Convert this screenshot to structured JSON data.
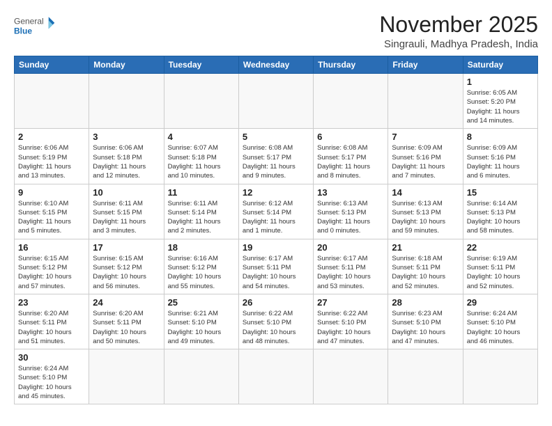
{
  "header": {
    "logo_general": "General",
    "logo_blue": "Blue",
    "title": "November 2025",
    "subtitle": "Singrauli, Madhya Pradesh, India"
  },
  "weekdays": [
    "Sunday",
    "Monday",
    "Tuesday",
    "Wednesday",
    "Thursday",
    "Friday",
    "Saturday"
  ],
  "weeks": [
    [
      {
        "day": "",
        "info": ""
      },
      {
        "day": "",
        "info": ""
      },
      {
        "day": "",
        "info": ""
      },
      {
        "day": "",
        "info": ""
      },
      {
        "day": "",
        "info": ""
      },
      {
        "day": "",
        "info": ""
      },
      {
        "day": "1",
        "info": "Sunrise: 6:05 AM\nSunset: 5:20 PM\nDaylight: 11 hours\nand 14 minutes."
      }
    ],
    [
      {
        "day": "2",
        "info": "Sunrise: 6:06 AM\nSunset: 5:19 PM\nDaylight: 11 hours\nand 13 minutes."
      },
      {
        "day": "3",
        "info": "Sunrise: 6:06 AM\nSunset: 5:18 PM\nDaylight: 11 hours\nand 12 minutes."
      },
      {
        "day": "4",
        "info": "Sunrise: 6:07 AM\nSunset: 5:18 PM\nDaylight: 11 hours\nand 10 minutes."
      },
      {
        "day": "5",
        "info": "Sunrise: 6:08 AM\nSunset: 5:17 PM\nDaylight: 11 hours\nand 9 minutes."
      },
      {
        "day": "6",
        "info": "Sunrise: 6:08 AM\nSunset: 5:17 PM\nDaylight: 11 hours\nand 8 minutes."
      },
      {
        "day": "7",
        "info": "Sunrise: 6:09 AM\nSunset: 5:16 PM\nDaylight: 11 hours\nand 7 minutes."
      },
      {
        "day": "8",
        "info": "Sunrise: 6:09 AM\nSunset: 5:16 PM\nDaylight: 11 hours\nand 6 minutes."
      }
    ],
    [
      {
        "day": "9",
        "info": "Sunrise: 6:10 AM\nSunset: 5:15 PM\nDaylight: 11 hours\nand 5 minutes."
      },
      {
        "day": "10",
        "info": "Sunrise: 6:11 AM\nSunset: 5:15 PM\nDaylight: 11 hours\nand 3 minutes."
      },
      {
        "day": "11",
        "info": "Sunrise: 6:11 AM\nSunset: 5:14 PM\nDaylight: 11 hours\nand 2 minutes."
      },
      {
        "day": "12",
        "info": "Sunrise: 6:12 AM\nSunset: 5:14 PM\nDaylight: 11 hours\nand 1 minute."
      },
      {
        "day": "13",
        "info": "Sunrise: 6:13 AM\nSunset: 5:13 PM\nDaylight: 11 hours\nand 0 minutes."
      },
      {
        "day": "14",
        "info": "Sunrise: 6:13 AM\nSunset: 5:13 PM\nDaylight: 10 hours\nand 59 minutes."
      },
      {
        "day": "15",
        "info": "Sunrise: 6:14 AM\nSunset: 5:13 PM\nDaylight: 10 hours\nand 58 minutes."
      }
    ],
    [
      {
        "day": "16",
        "info": "Sunrise: 6:15 AM\nSunset: 5:12 PM\nDaylight: 10 hours\nand 57 minutes."
      },
      {
        "day": "17",
        "info": "Sunrise: 6:15 AM\nSunset: 5:12 PM\nDaylight: 10 hours\nand 56 minutes."
      },
      {
        "day": "18",
        "info": "Sunrise: 6:16 AM\nSunset: 5:12 PM\nDaylight: 10 hours\nand 55 minutes."
      },
      {
        "day": "19",
        "info": "Sunrise: 6:17 AM\nSunset: 5:11 PM\nDaylight: 10 hours\nand 54 minutes."
      },
      {
        "day": "20",
        "info": "Sunrise: 6:17 AM\nSunset: 5:11 PM\nDaylight: 10 hours\nand 53 minutes."
      },
      {
        "day": "21",
        "info": "Sunrise: 6:18 AM\nSunset: 5:11 PM\nDaylight: 10 hours\nand 52 minutes."
      },
      {
        "day": "22",
        "info": "Sunrise: 6:19 AM\nSunset: 5:11 PM\nDaylight: 10 hours\nand 52 minutes."
      }
    ],
    [
      {
        "day": "23",
        "info": "Sunrise: 6:20 AM\nSunset: 5:11 PM\nDaylight: 10 hours\nand 51 minutes."
      },
      {
        "day": "24",
        "info": "Sunrise: 6:20 AM\nSunset: 5:11 PM\nDaylight: 10 hours\nand 50 minutes."
      },
      {
        "day": "25",
        "info": "Sunrise: 6:21 AM\nSunset: 5:10 PM\nDaylight: 10 hours\nand 49 minutes."
      },
      {
        "day": "26",
        "info": "Sunrise: 6:22 AM\nSunset: 5:10 PM\nDaylight: 10 hours\nand 48 minutes."
      },
      {
        "day": "27",
        "info": "Sunrise: 6:22 AM\nSunset: 5:10 PM\nDaylight: 10 hours\nand 47 minutes."
      },
      {
        "day": "28",
        "info": "Sunrise: 6:23 AM\nSunset: 5:10 PM\nDaylight: 10 hours\nand 47 minutes."
      },
      {
        "day": "29",
        "info": "Sunrise: 6:24 AM\nSunset: 5:10 PM\nDaylight: 10 hours\nand 46 minutes."
      }
    ],
    [
      {
        "day": "30",
        "info": "Sunrise: 6:24 AM\nSunset: 5:10 PM\nDaylight: 10 hours\nand 45 minutes."
      },
      {
        "day": "",
        "info": ""
      },
      {
        "day": "",
        "info": ""
      },
      {
        "day": "",
        "info": ""
      },
      {
        "day": "",
        "info": ""
      },
      {
        "day": "",
        "info": ""
      },
      {
        "day": "",
        "info": ""
      }
    ]
  ]
}
